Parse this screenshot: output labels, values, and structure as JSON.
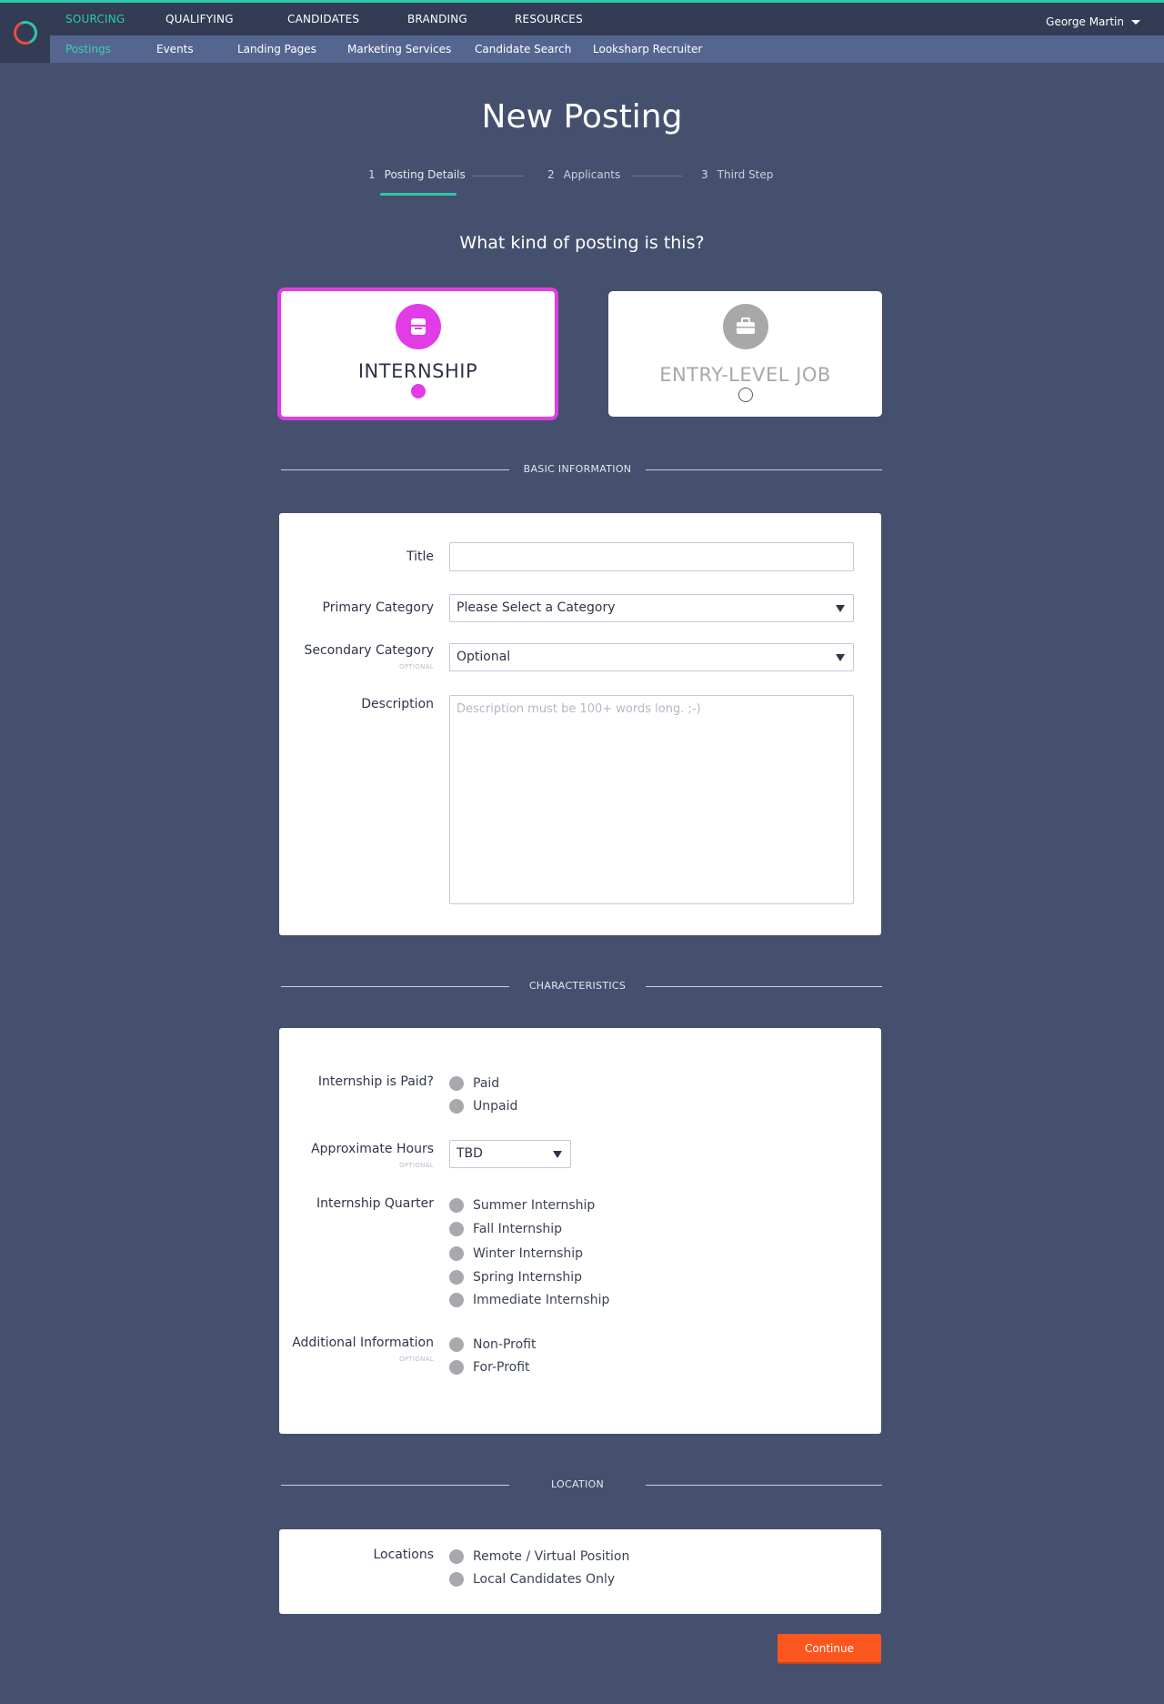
{
  "nav": {
    "main": [
      "SOURCING",
      "QUALIFYING",
      "CANDIDATES",
      "BRANDING",
      "RESOURCES"
    ],
    "sub": [
      "Postings",
      "Events",
      "Landing Pages",
      "Marketing Services",
      "Candidate Search",
      "Looksharp Recruiter"
    ],
    "user": "George Martin"
  },
  "page": {
    "title": "New Posting"
  },
  "steps": [
    {
      "num": "1",
      "label": "Posting Details",
      "active": true
    },
    {
      "num": "2",
      "label": "Applicants"
    },
    {
      "num": "3",
      "label": "Third Step"
    }
  ],
  "type_question": "What kind of posting is this?",
  "posting_types": [
    {
      "label": "INTERNSHIP",
      "selected": true,
      "icon": "inbox-icon",
      "color": "#e23ce6"
    },
    {
      "label": "ENTRY-LEVEL JOB",
      "selected": false,
      "icon": "briefcase-icon",
      "color": "#a8a8a8"
    }
  ],
  "sections": {
    "basic": "BASIC INFORMATION",
    "characteristics": "CHARACTERISTICS",
    "location": "LOCATION"
  },
  "basic": {
    "title_label": "Title",
    "title_value": "",
    "primary_label": "Primary Category",
    "primary_value": "Please Select a Category",
    "secondary_label": "Secondary Category",
    "secondary_value": "Optional",
    "description_label": "Description",
    "description_placeholder": "Description must be 100+ words long. ;-)",
    "optional_tag": "OPTIONAL"
  },
  "characteristics": {
    "paid_label": "Internship is Paid?",
    "paid_options": [
      "Paid",
      "Unpaid"
    ],
    "hours_label": "Approximate Hours",
    "hours_value": "TBD",
    "quarter_label": "Internship Quarter",
    "quarter_options": [
      "Summer Internship",
      "Fall Internship",
      "Winter Internship",
      "Spring Internship",
      "Immediate Internship"
    ],
    "additional_label": "Additional Information",
    "additional_options": [
      "Non-Profit",
      "For-Profit"
    ],
    "optional_tag": "OPTIONAL"
  },
  "location": {
    "label": "Locations",
    "options": [
      "Remote / Virtual Position",
      "Local Candidates Only"
    ]
  },
  "actions": {
    "continue": "Continue"
  },
  "colors": {
    "accent": "#2cc9a7",
    "selected": "#e23ce6",
    "cta": "#fc561f",
    "background": "#45506e"
  }
}
